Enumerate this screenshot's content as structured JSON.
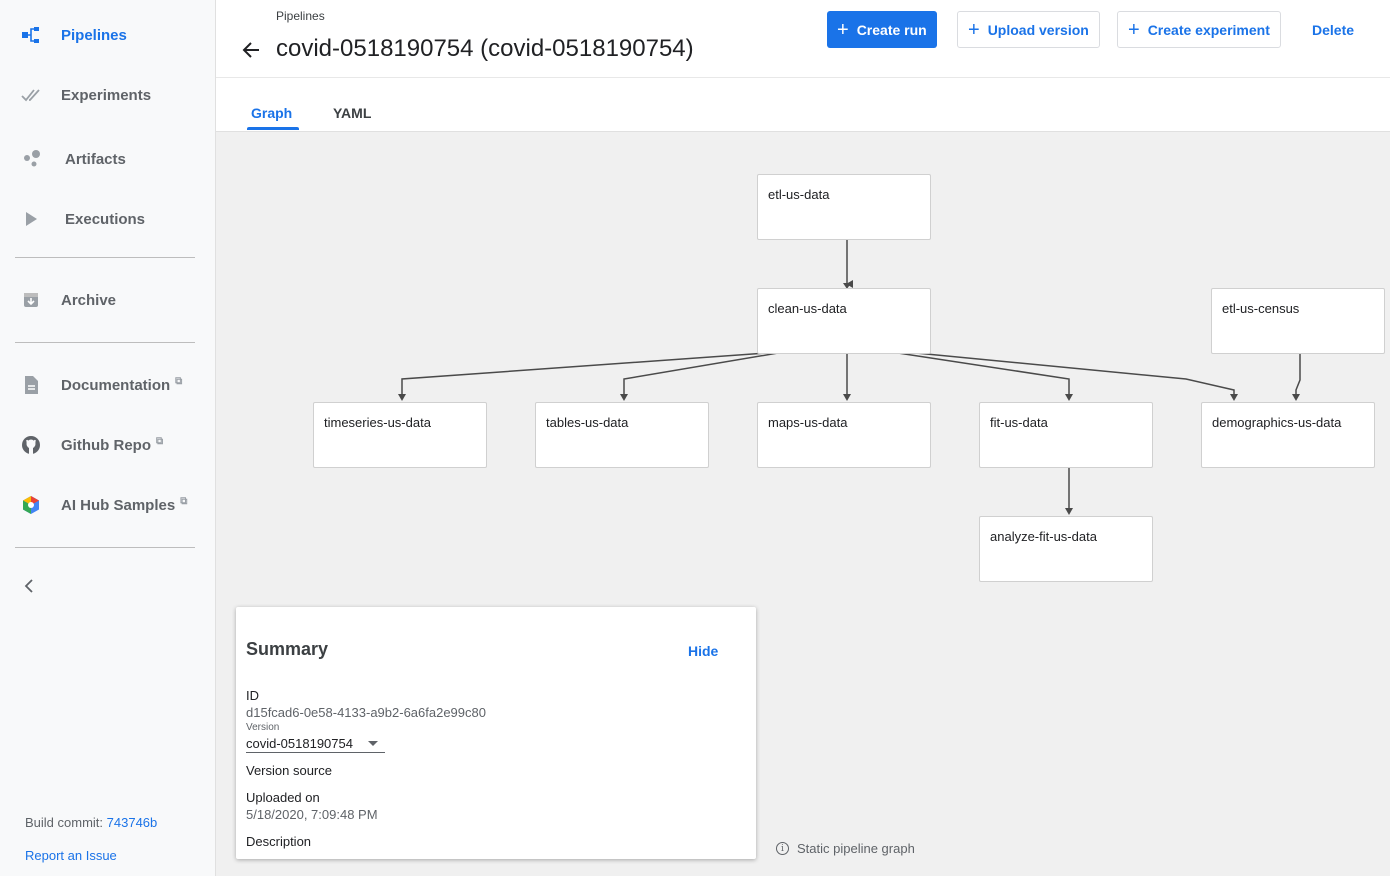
{
  "sidebar": {
    "items": [
      {
        "label": "Pipelines",
        "icon": "pipelines-icon",
        "active": true
      },
      {
        "label": "Experiments",
        "icon": "experiments-icon",
        "active": false
      },
      {
        "label": "Artifacts",
        "icon": "artifacts-icon",
        "active": false
      },
      {
        "label": "Executions",
        "icon": "executions-icon",
        "active": false
      },
      {
        "label": "Archive",
        "icon": "archive-icon",
        "active": false
      }
    ],
    "links": [
      {
        "label": "Documentation",
        "icon": "document-icon"
      },
      {
        "label": "Github Repo",
        "icon": "github-icon"
      },
      {
        "label": "AI Hub Samples",
        "icon": "ai-hub-icon"
      }
    ],
    "collapse_icon": "chevron-left-icon",
    "build_commit_label": "Build commit:",
    "build_commit_hash": "743746b",
    "report_issue": "Report an Issue"
  },
  "header": {
    "breadcrumb": "Pipelines",
    "title": "covid-0518190754 (covid-0518190754)",
    "create_run": "Create run",
    "upload_version": "Upload version",
    "create_experiment": "Create experiment",
    "delete": "Delete"
  },
  "tabs": {
    "graph": "Graph",
    "yaml": "YAML",
    "active": "Graph"
  },
  "graph": {
    "nodes": {
      "etl_us_data": "etl-us-data",
      "clean_us_data": "clean-us-data",
      "etl_us_census": "etl-us-census",
      "timeseries_us_data": "timeseries-us-data",
      "tables_us_data": "tables-us-data",
      "maps_us_data": "maps-us-data",
      "fit_us_data": "fit-us-data",
      "demographics_us_data": "demographics-us-data",
      "analyze_fit_us_data": "analyze-fit-us-data"
    },
    "static_note": "Static pipeline graph"
  },
  "summary": {
    "title": "Summary",
    "hide": "Hide",
    "id_label": "ID",
    "id_value": "d15fcad6-0e58-4133-a9b2-6a6fa2e99c80",
    "version_label": "Version",
    "version_value": "covid-0518190754",
    "version_source_label": "Version source",
    "uploaded_on_label": "Uploaded on",
    "uploaded_on_value": "5/18/2020, 7:09:48 PM",
    "description_label": "Description"
  },
  "colors": {
    "accent": "#1a73e8",
    "canvas_bg": "#f0f0f0",
    "sidebar_bg": "#f8f9fa"
  }
}
